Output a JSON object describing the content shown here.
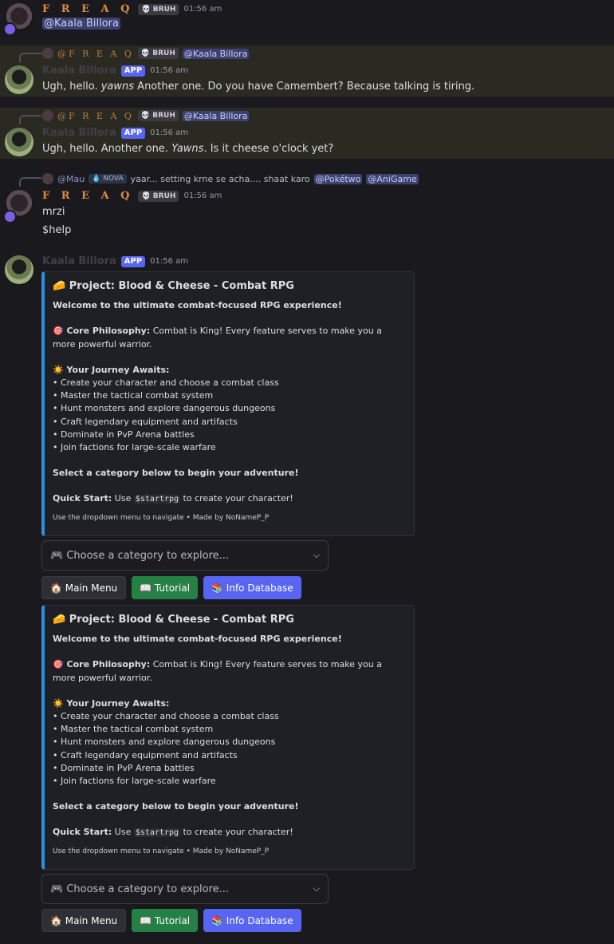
{
  "users": {
    "freaq": "F R E A Q",
    "kaala": "Kaala Billora",
    "mau": "@Mau"
  },
  "tags": {
    "bruh": "💀 BRUH",
    "app": "APP",
    "nova": "💧 NOVA"
  },
  "msg1": {
    "time": "01:56 am",
    "mention": "@Kaala Billora"
  },
  "msg2": {
    "reply_name": "@F R E A Q",
    "reply_mention": "@Kaala Billora",
    "time": "01:56 am",
    "text_a": "Ugh, hello. ",
    "text_yawn": "yawns",
    "text_b": " Another one.  Do you have Camembert?  Because talking is tiring."
  },
  "msg3": {
    "reply_name": "@F R E A Q",
    "reply_mention": "@Kaala Billora",
    "time": "01:56 am",
    "text_a": "Ugh, hello.  Another one. ",
    "text_yawn": "Yawns",
    "text_b": ".  Is it cheese o'clock yet?"
  },
  "msg4": {
    "reply_text": "yaar... setting krne se acha.... shaat karo",
    "reply_m1": "@Pokétwo",
    "reply_m2": "@AniGame",
    "time": "01:56 am",
    "line1": "mrzi",
    "line2": "$help"
  },
  "msg5": {
    "time": "01:56 am"
  },
  "embed": {
    "title": "🧀 Project: Blood & Cheese - Combat RPG",
    "welcome": "Welcome to the ultimate combat-focused RPG experience!",
    "philo_label": "🎯 Core Philosophy:",
    "philo_text": " Combat is King! Every feature serves to make you a more powerful warrior.",
    "journey_label": "☀️ Your Journey Awaits:",
    "items": [
      "• Create your character and choose a combat class",
      "• Master the tactical combat system",
      "• Hunt monsters and explore dangerous dungeons",
      "• Craft legendary equipment and artifacts",
      "• Dominate in PvP Arena battles",
      "• Join factions for large-scale warfare"
    ],
    "select_line": "Select a category below to begin your adventure!",
    "quick_label": "Quick Start:",
    "quick_pre": " Use ",
    "quick_code": "$startrpg",
    "quick_post": " to create your character!",
    "footer": "Use the dropdown menu to navigate • Made by NoNameP_P"
  },
  "controls": {
    "select_placeholder": "🎮 Choose a category to explore...",
    "btn_main": "🏠 Main Menu",
    "btn_tutorial": "📖 Tutorial",
    "btn_info": "📚 Info Database"
  },
  "colors": {
    "accent": "#5865f2",
    "embed_border": "#2f8fd8",
    "freaq": "#e08b3c",
    "green": "#248045"
  }
}
